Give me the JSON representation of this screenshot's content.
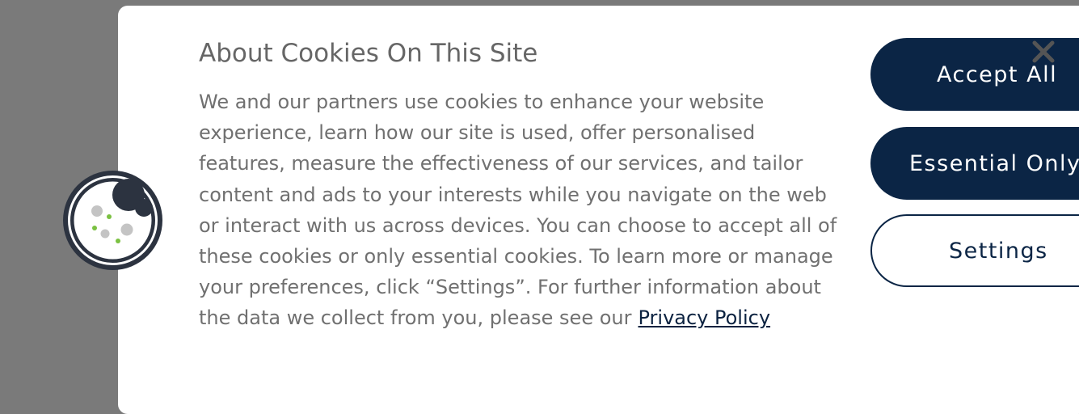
{
  "banner": {
    "title": "About Cookies On This Site",
    "body": "We and our partners use cookies to enhance your website experience, learn how our site is used, offer personalised features, measure the effectiveness of our services, and tailor content and ads to your interests while you navigate on the web or interact with us across devices. You can choose to accept all of these cookies or only essential cookies. To learn more or manage your preferences, click “Settings”. For further information about the data we collect from you, please see our",
    "privacy_link": "Privacy Policy",
    "icon": "cookie-icon",
    "close_icon": "close-icon"
  },
  "buttons": {
    "accept_all": "Accept All",
    "essential_only": "Essential Only",
    "settings": "Settings"
  },
  "colors": {
    "primary": "#0b2545",
    "badge": "#2c3340",
    "text": "#707070",
    "overlay": "#7a7a7a"
  }
}
